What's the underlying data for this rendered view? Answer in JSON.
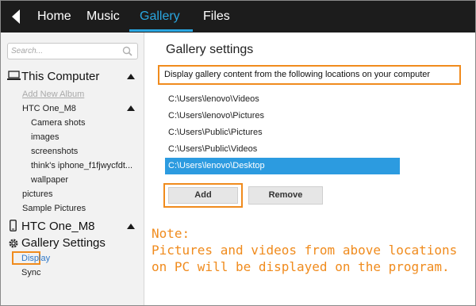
{
  "nav": {
    "tabs": [
      {
        "label": "Home",
        "active": false
      },
      {
        "label": "Music",
        "active": false
      },
      {
        "label": "Gallery",
        "active": true
      },
      {
        "label": "Files",
        "active": false
      }
    ]
  },
  "sidebar": {
    "search_placeholder": "Search...",
    "computer_section": {
      "title": "This Computer",
      "add_album_link": "Add New Album",
      "device_folder": "HTC One_M8",
      "subfolders": [
        "Camera shots",
        "images",
        "screenshots",
        "think's iphone_f1fjwycfdt...",
        "wallpaper"
      ],
      "folders": [
        "pictures",
        "Sample Pictures"
      ]
    },
    "phone_section": {
      "title": "HTC One_M8"
    },
    "settings_section": {
      "title": "Gallery Settings",
      "items": [
        "Display",
        "Sync"
      ]
    }
  },
  "main": {
    "title": "Gallery settings",
    "description": "Display gallery content from the following locations on your computer",
    "paths": [
      {
        "text": "C:\\Users\\lenovo\\Videos",
        "selected": false
      },
      {
        "text": "C:\\Users\\lenovo\\Pictures",
        "selected": false
      },
      {
        "text": "C:\\Users\\Public\\Pictures",
        "selected": false
      },
      {
        "text": "C:\\Users\\Public\\Videos",
        "selected": false
      },
      {
        "text": "C:\\Users\\lenovo\\Desktop",
        "selected": true
      }
    ],
    "add_label": "Add",
    "remove_label": "Remove"
  },
  "note": {
    "line1": "Note:",
    "line2": "Pictures and videos from above locations",
    "line3": "on PC will be displayed on the program."
  },
  "colors": {
    "accent_blue": "#2aa6e0",
    "selection_blue": "#2c9be0",
    "highlight_orange": "#f08b1d",
    "topbar": "#1c1c1c"
  }
}
